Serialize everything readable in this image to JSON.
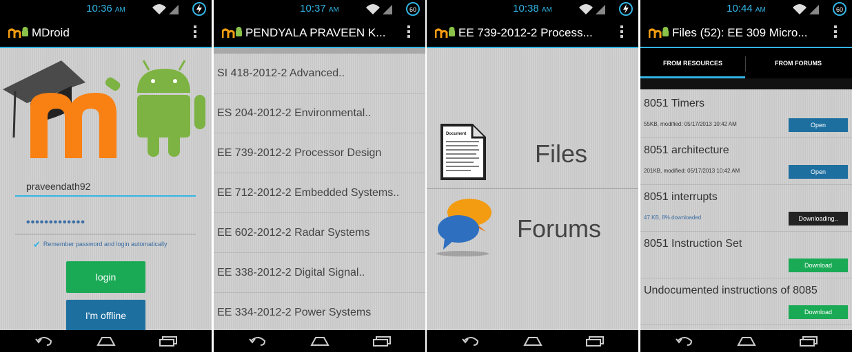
{
  "screen1": {
    "time": "10:36",
    "ampm": "AM",
    "title": "MDroid",
    "username": "praveendath92",
    "password_mask": "•••••••••••••",
    "remember_label": "Remember password and login automatically",
    "login_label": "login",
    "offline_label": "I'm offline"
  },
  "screen2": {
    "time": "10:37",
    "ampm": "AM",
    "battery": "60",
    "title": "PENDYALA PRAVEEN K...",
    "courses": [
      "SI 418-2012-2 Advanced..",
      "ES 204-2012-2 Environmental..",
      "EE 739-2012-2 Processor Design",
      "EE 712-2012-2 Embedded Systems..",
      "EE 602-2012-2 Radar Systems",
      "EE 338-2012-2 Digital Signal..",
      "EE 334-2012-2 Power Systems"
    ]
  },
  "screen3": {
    "time": "10:38",
    "ampm": "AM",
    "title": "EE 739-2012-2 Process...",
    "files_label": "Files",
    "forums_label": "Forums"
  },
  "screen4": {
    "time": "10:44",
    "ampm": "AM",
    "battery": "60",
    "title": "Files (52): EE 309 Micro...",
    "tabs": [
      "FROM RESOURCES",
      "FROM FORUMS"
    ],
    "files": [
      {
        "name": "8051 Timers",
        "meta": "55KB, modified: 05/17/2013 10:42 AM",
        "action": "Open"
      },
      {
        "name": "8051 architecture",
        "meta": "201KB, modified: 05/17/2013 10:42 AM",
        "action": "Open"
      },
      {
        "name": "8051 interrupts",
        "meta": "47 KB, 8% downloaded",
        "action": "Downloading.."
      },
      {
        "name": "8051 Instruction Set",
        "meta": "",
        "action": "Download"
      },
      {
        "name": "Undocumented instructions of 8085",
        "meta": "",
        "action": "Download"
      }
    ]
  },
  "colors": {
    "accent": "#33b5e5",
    "green_button": "#1aaa55",
    "blue_button": "#1d6fa0"
  }
}
